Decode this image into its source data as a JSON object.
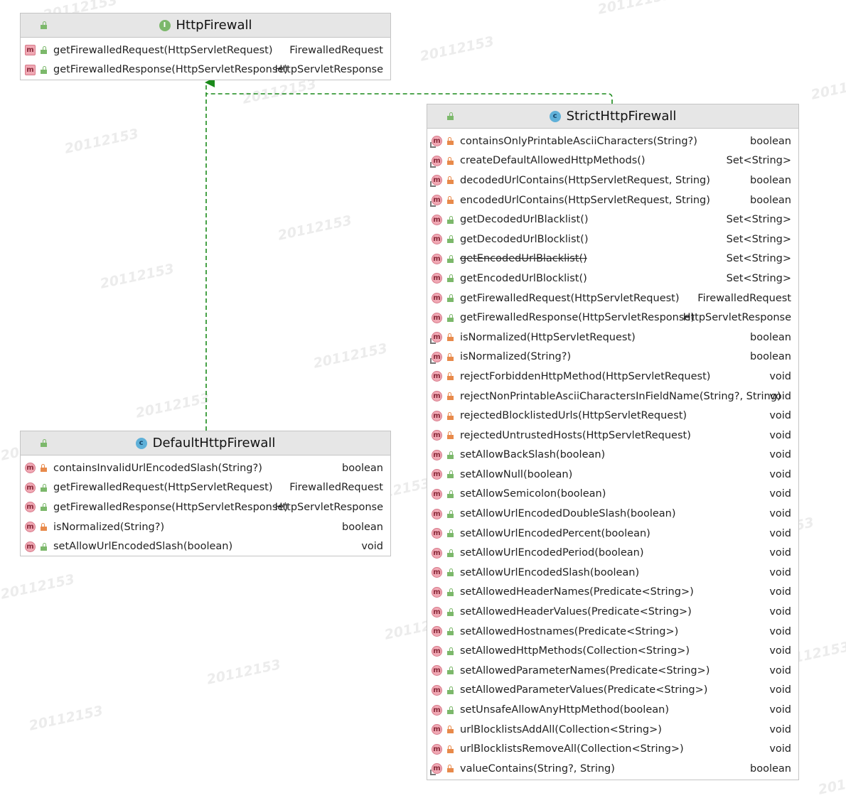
{
  "watermark": "20112153",
  "colors": {
    "edge_realization": "#1a8a1a",
    "header_bg": "#e6e6e6",
    "border": "#c4c4c4"
  },
  "classes": [
    {
      "name": "HttpFirewall",
      "kind": "interface",
      "kind_glyph": "I",
      "members": [
        {
          "name": "getFirewalledRequest(HttpServletRequest)",
          "type": "FirewalledRequest",
          "visibility": "public",
          "icon": "method-abstract-icon"
        },
        {
          "name": "getFirewalledResponse(HttpServletResponse)",
          "type": "HttpServletResponse",
          "visibility": "public",
          "icon": "method-abstract-icon"
        }
      ]
    },
    {
      "name": "StrictHttpFirewall",
      "kind": "class",
      "kind_glyph": "c",
      "members": [
        {
          "name": "containsOnlyPrintableAsciiCharacters(String?)",
          "type": "boolean",
          "visibility": "private",
          "icon": "method-static-icon"
        },
        {
          "name": "createDefaultAllowedHttpMethods()",
          "type": "Set<String>",
          "visibility": "private",
          "icon": "method-static-icon"
        },
        {
          "name": "decodedUrlContains(HttpServletRequest, String)",
          "type": "boolean",
          "visibility": "private",
          "icon": "method-static-icon"
        },
        {
          "name": "encodedUrlContains(HttpServletRequest, String)",
          "type": "boolean",
          "visibility": "private",
          "icon": "method-static-icon"
        },
        {
          "name": "getDecodedUrlBlacklist()",
          "type": "Set<String>",
          "visibility": "public",
          "icon": "method-icon"
        },
        {
          "name": "getDecodedUrlBlocklist()",
          "type": "Set<String>",
          "visibility": "public",
          "icon": "method-icon"
        },
        {
          "name": "getEncodedUrlBlacklist()",
          "type": "Set<String>",
          "visibility": "public",
          "icon": "method-icon",
          "deprecated": true
        },
        {
          "name": "getEncodedUrlBlocklist()",
          "type": "Set<String>",
          "visibility": "public",
          "icon": "method-icon"
        },
        {
          "name": "getFirewalledRequest(HttpServletRequest)",
          "type": "FirewalledRequest",
          "visibility": "public",
          "icon": "method-icon"
        },
        {
          "name": "getFirewalledResponse(HttpServletResponse)",
          "type": "HttpServletResponse",
          "visibility": "public",
          "icon": "method-icon"
        },
        {
          "name": "isNormalized(HttpServletRequest)",
          "type": "boolean",
          "visibility": "private",
          "icon": "method-static-icon"
        },
        {
          "name": "isNormalized(String?)",
          "type": "boolean",
          "visibility": "private",
          "icon": "method-static-icon"
        },
        {
          "name": "rejectForbiddenHttpMethod(HttpServletRequest)",
          "type": "void",
          "visibility": "private",
          "icon": "method-icon"
        },
        {
          "name": "rejectNonPrintableAsciiCharactersInFieldName(String?, String)",
          "type": "void",
          "visibility": "private",
          "icon": "method-icon"
        },
        {
          "name": "rejectedBlocklistedUrls(HttpServletRequest)",
          "type": "void",
          "visibility": "private",
          "icon": "method-icon"
        },
        {
          "name": "rejectedUntrustedHosts(HttpServletRequest)",
          "type": "void",
          "visibility": "private",
          "icon": "method-icon"
        },
        {
          "name": "setAllowBackSlash(boolean)",
          "type": "void",
          "visibility": "public",
          "icon": "method-icon"
        },
        {
          "name": "setAllowNull(boolean)",
          "type": "void",
          "visibility": "public",
          "icon": "method-icon"
        },
        {
          "name": "setAllowSemicolon(boolean)",
          "type": "void",
          "visibility": "public",
          "icon": "method-icon"
        },
        {
          "name": "setAllowUrlEncodedDoubleSlash(boolean)",
          "type": "void",
          "visibility": "public",
          "icon": "method-icon"
        },
        {
          "name": "setAllowUrlEncodedPercent(boolean)",
          "type": "void",
          "visibility": "public",
          "icon": "method-icon"
        },
        {
          "name": "setAllowUrlEncodedPeriod(boolean)",
          "type": "void",
          "visibility": "public",
          "icon": "method-icon"
        },
        {
          "name": "setAllowUrlEncodedSlash(boolean)",
          "type": "void",
          "visibility": "public",
          "icon": "method-icon"
        },
        {
          "name": "setAllowedHeaderNames(Predicate<String>)",
          "type": "void",
          "visibility": "public",
          "icon": "method-icon"
        },
        {
          "name": "setAllowedHeaderValues(Predicate<String>)",
          "type": "void",
          "visibility": "public",
          "icon": "method-icon"
        },
        {
          "name": "setAllowedHostnames(Predicate<String>)",
          "type": "void",
          "visibility": "public",
          "icon": "method-icon"
        },
        {
          "name": "setAllowedHttpMethods(Collection<String>)",
          "type": "void",
          "visibility": "public",
          "icon": "method-icon"
        },
        {
          "name": "setAllowedParameterNames(Predicate<String>)",
          "type": "void",
          "visibility": "public",
          "icon": "method-icon"
        },
        {
          "name": "setAllowedParameterValues(Predicate<String>)",
          "type": "void",
          "visibility": "public",
          "icon": "method-icon"
        },
        {
          "name": "setUnsafeAllowAnyHttpMethod(boolean)",
          "type": "void",
          "visibility": "public",
          "icon": "method-icon"
        },
        {
          "name": "urlBlocklistsAddAll(Collection<String>)",
          "type": "void",
          "visibility": "private",
          "icon": "method-icon"
        },
        {
          "name": "urlBlocklistsRemoveAll(Collection<String>)",
          "type": "void",
          "visibility": "private",
          "icon": "method-icon"
        },
        {
          "name": "valueContains(String?, String)",
          "type": "boolean",
          "visibility": "private",
          "icon": "method-static-icon"
        }
      ]
    },
    {
      "name": "DefaultHttpFirewall",
      "kind": "class",
      "kind_glyph": "c",
      "members": [
        {
          "name": "containsInvalidUrlEncodedSlash(String?)",
          "type": "boolean",
          "visibility": "private",
          "icon": "method-icon"
        },
        {
          "name": "getFirewalledRequest(HttpServletRequest)",
          "type": "FirewalledRequest",
          "visibility": "public",
          "icon": "method-icon"
        },
        {
          "name": "getFirewalledResponse(HttpServletResponse)",
          "type": "HttpServletResponse",
          "visibility": "public",
          "icon": "method-icon"
        },
        {
          "name": "isNormalized(String?)",
          "type": "boolean",
          "visibility": "private",
          "icon": "method-icon"
        },
        {
          "name": "setAllowUrlEncodedSlash(boolean)",
          "type": "void",
          "visibility": "public",
          "icon": "method-icon"
        }
      ]
    }
  ],
  "edges": [
    {
      "from": "StrictHttpFirewall",
      "to": "HttpFirewall",
      "relation": "implements"
    },
    {
      "from": "DefaultHttpFirewall",
      "to": "HttpFirewall",
      "relation": "implements"
    }
  ]
}
